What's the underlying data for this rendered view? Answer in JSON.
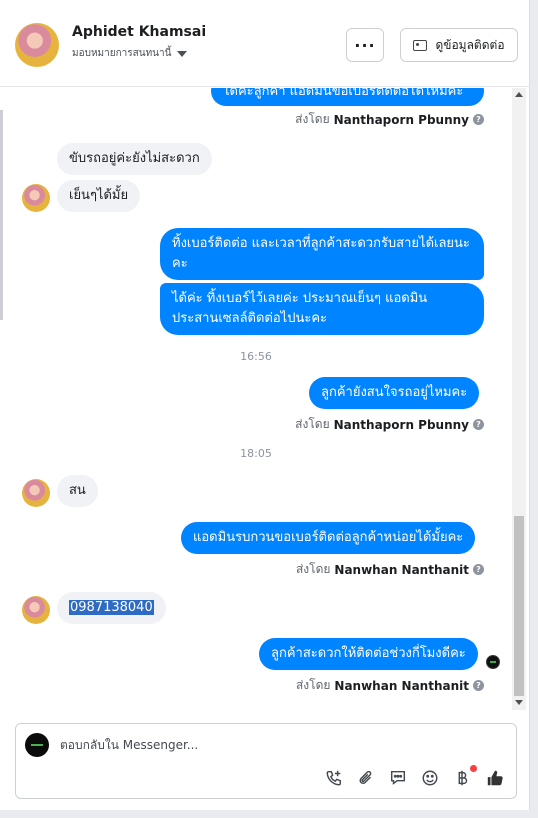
{
  "header": {
    "name": "Aphidet Khamsai",
    "subtitle": "มอบหมายการสนทนานี้",
    "more_label": "···",
    "contact_label": "ดูข้อมูลติดต่อ"
  },
  "messages": {
    "m1": {
      "text": "ได้ค่ะลูกค้า แอดมินขอเบอร์ติดต่อได้ไหมคะ",
      "sent_prefix": "ส่งโดย",
      "sender": "Nanthaporn Pbunny"
    },
    "m2": {
      "text": "ขับรถอยู่ค่ะยังไม่สะดวก"
    },
    "m3": {
      "text": "เย็นๆได้มั้ย"
    },
    "m4": {
      "text": "ทิ้งเบอร์ติดต่อ และเวลาที่ลูกค้าสะดวกรับสายได้เลยนะคะ"
    },
    "m5": {
      "text": "ได้ค่ะ ทิ้งเบอร์ไว้เลยค่ะ ประมาณเย็นๆ แอดมินประสานเซลล์ติดต่อไปนะคะ"
    },
    "ts1": "16:56",
    "m6": {
      "text": "ลูกค้ายังสนใจรถอยู่ไหมคะ",
      "sent_prefix": "ส่งโดย",
      "sender": "Nanthaporn Pbunny"
    },
    "ts2": "18:05",
    "m7": {
      "text": "สน"
    },
    "m8": {
      "text": "แอดมินรบกวนขอเบอร์ติดต่อลูกค้าหน่อยได้มั้ยคะ",
      "sent_prefix": "ส่งโดย",
      "sender": "Nanwhan Nanthanit"
    },
    "m9": {
      "text": "0987138040"
    },
    "m10": {
      "text": "ลูกค้าสะดวกให้ติดต่อช่วงกี่โมงดีคะ",
      "sent_prefix": "ส่งโดย",
      "sender": "Nanwhan Nanthanit"
    }
  },
  "composer": {
    "placeholder": "ตอบกลับใน Messenger...",
    "tools": [
      "phone-plus-icon",
      "paperclip-icon",
      "saved-reply-icon",
      "emoji-icon",
      "baht-icon",
      "thumbs-up-icon"
    ]
  },
  "colors": {
    "outgoing": "#0084ff",
    "incoming": "#f0f2f5"
  }
}
